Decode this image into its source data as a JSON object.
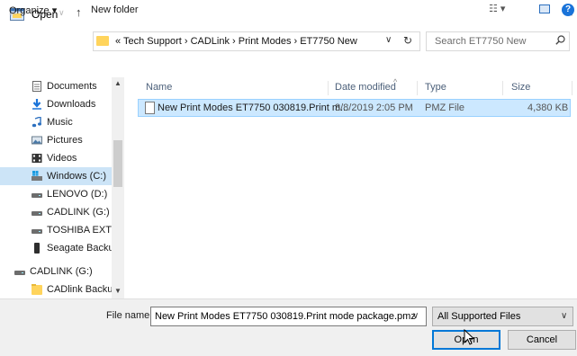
{
  "window": {
    "title": "Open",
    "close_glyph": "×"
  },
  "address": {
    "crumbs": "« Tech Support › CADLink › Print Modes › ET7750 New",
    "search_placeholder": "Search ET7750 New"
  },
  "toolbar": {
    "organize": "Organize ▾",
    "new_folder": "New folder"
  },
  "nav": {
    "items": [
      {
        "label": "Documents",
        "icon": "documents-icon"
      },
      {
        "label": "Downloads",
        "icon": "downloads-icon"
      },
      {
        "label": "Music",
        "icon": "music-icon"
      },
      {
        "label": "Pictures",
        "icon": "pictures-icon"
      },
      {
        "label": "Videos",
        "icon": "videos-icon"
      },
      {
        "label": "Windows (C:)",
        "icon": "drive-icon"
      },
      {
        "label": "LENOVO (D:)",
        "icon": "drive-icon"
      },
      {
        "label": "CADLINK (G:)",
        "icon": "drive-icon"
      },
      {
        "label": "TOSHIBA EXT (H",
        "icon": "drive-icon"
      },
      {
        "label": "Seagate Backup",
        "icon": "drive-icon"
      },
      {
        "label": "CADLINK (G:)",
        "icon": "drive-icon"
      },
      {
        "label": "CADlink Backup",
        "icon": "folder-icon"
      }
    ],
    "selected_index": 5
  },
  "columns": {
    "name": "Name",
    "date": "Date modified",
    "type": "Type",
    "size": "Size"
  },
  "files": [
    {
      "name": "New Print Modes ET7750 030819.Print m...",
      "date": "3/8/2019 2:05 PM",
      "type": "PMZ File",
      "size": "4,380 KB"
    }
  ],
  "bottom": {
    "file_name_label": "File name:",
    "file_name_value": "New Print Modes ET7750 030819.Print mode package.pmz",
    "file_type": "All Supported Files",
    "open_label": "Open",
    "cancel_label": "Cancel"
  },
  "colors": {
    "selection": "#cce8ff",
    "accent": "#0078d7",
    "folder": "#ffd45c"
  }
}
